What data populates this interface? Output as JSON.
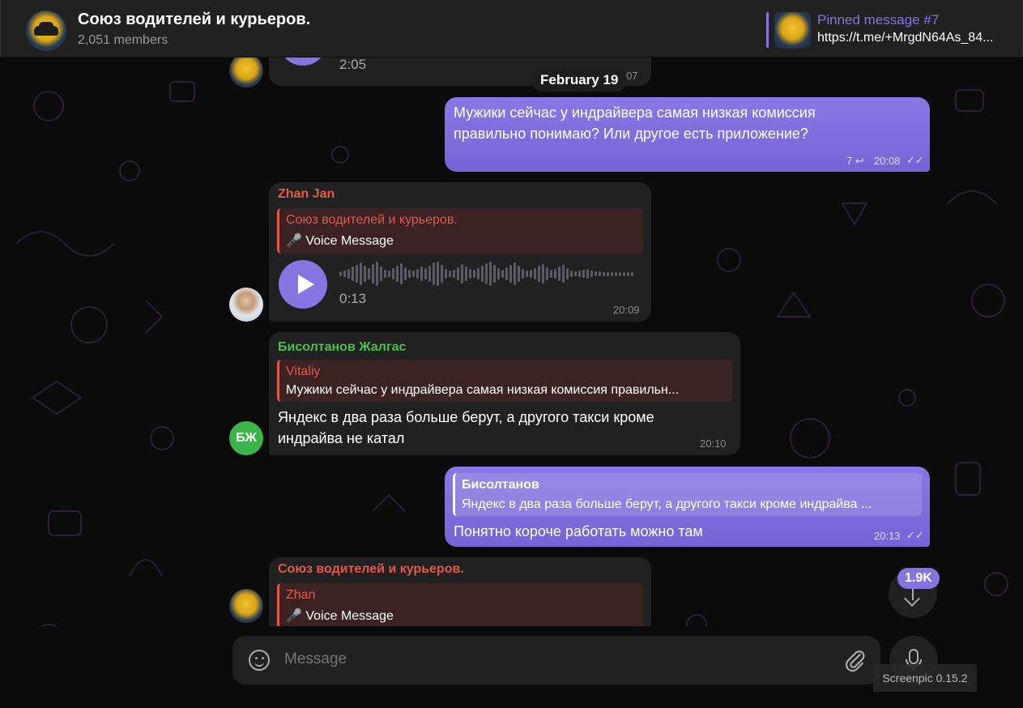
{
  "header": {
    "title": "Союз водителей и курьеров.",
    "members": "2,051 members",
    "pinned_title": "Pinned message #7",
    "pinned_text": "https://t.me/+MrgdN64As_84..."
  },
  "date_separator": "February 19",
  "messages": {
    "prev_voice": {
      "duration": "2:05",
      "time": "20:07"
    },
    "m1": {
      "text_line1": "Мужики сейчас у индрайвера самая низкая комиссия",
      "text_line2": "правильно понимаю? Или другое есть приложение?",
      "replies": "7",
      "time": "20:08"
    },
    "m2": {
      "sender": "Zhan Jan",
      "reply_name": "Союз водителей и курьеров.",
      "reply_text": "🎤 Voice Message",
      "duration": "0:13",
      "time": "20:09"
    },
    "m3": {
      "sender": "Бисолтанов Жалгас",
      "avatar_initials": "БЖ",
      "reply_name": "Vitaliy",
      "reply_text": "Мужики сейчас у индрайвера самая низкая комиссия правильн...",
      "text_line1": "Яндекс в два раза больше берут, а другого такси кроме",
      "text_line2": "индрайва не катал",
      "time": "20:10"
    },
    "m4": {
      "reply_name": "Бисолтанов",
      "reply_text": "Яндекс в два раза больше берут, а другого такси кроме индрайва ...",
      "text": "Понятно короче работать можно там",
      "time": "20:13"
    },
    "m5": {
      "sender": "Союз водителей и курьеров.",
      "reply_name": "Zhan",
      "reply_text": "🎤 Voice Message"
    }
  },
  "scroll_badge": "1.9K",
  "composer": {
    "placeholder": "Message"
  },
  "watermark": "Screenpic 0.15.2",
  "colors": {
    "accent": "#8774e1",
    "sender_red": "#e4594a",
    "sender_green": "#4fbf4f",
    "bubble_in": "#212121"
  },
  "icons": [
    "play-icon",
    "emoji-icon",
    "attach-icon",
    "mic-icon",
    "arrow-down-icon",
    "reply-count-icon",
    "double-check-icon"
  ]
}
